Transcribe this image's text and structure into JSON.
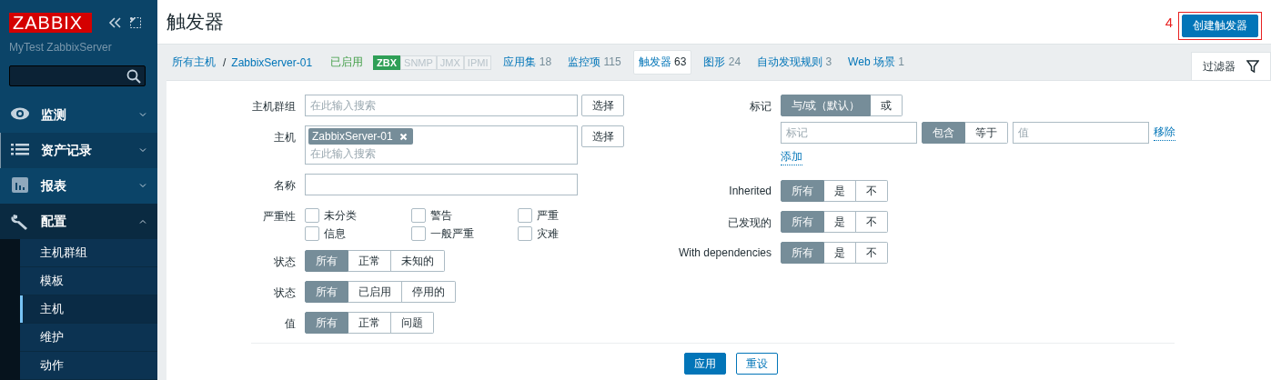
{
  "sidebar": {
    "logo": "ZABBIX",
    "server_name": "MyTest ZabbixServer",
    "menu": [
      {
        "label": "监测",
        "expanded": false,
        "highlighted": false
      },
      {
        "label": "资产记录",
        "expanded": false,
        "highlighted": true
      },
      {
        "label": "报表",
        "expanded": false,
        "highlighted": false
      },
      {
        "label": "配置",
        "expanded": true,
        "highlighted": false,
        "children": [
          {
            "label": "主机群组",
            "selected": false
          },
          {
            "label": "模板",
            "selected": false
          },
          {
            "label": "主机",
            "selected": true
          },
          {
            "label": "维护",
            "selected": false
          },
          {
            "label": "动作",
            "selected": false
          }
        ]
      }
    ]
  },
  "header": {
    "title": "触发器",
    "annotation": "4",
    "create_button": "创建触发器"
  },
  "nav": {
    "breadcrumb": [
      "所有主机",
      "ZabbixServer-01"
    ],
    "breadcrumb_separator": "/",
    "status": "已启用",
    "availability": [
      {
        "label": "ZBX",
        "on": true
      },
      {
        "label": "SNMP",
        "on": false
      },
      {
        "label": "JMX",
        "on": false
      },
      {
        "label": "IPMI",
        "on": false
      }
    ],
    "tabs": [
      {
        "label": "应用集",
        "count": "18",
        "selected": false
      },
      {
        "label": "监控项",
        "count": "115",
        "selected": false
      },
      {
        "label": "触发器",
        "count": "63",
        "selected": true
      },
      {
        "label": "图形",
        "count": "24",
        "selected": false
      },
      {
        "label": "自动发现规则",
        "count": "3",
        "selected": false
      },
      {
        "label": "Web 场景",
        "count": "1",
        "selected": false
      }
    ],
    "filter_tab": {
      "label": "过滤器",
      "selected": true
    }
  },
  "filter": {
    "left": [
      {
        "kind": "multiselect",
        "label": "主机群组",
        "placeholder": "在此输入搜索",
        "button": "选择"
      },
      {
        "kind": "multiselect",
        "label": "主机",
        "chips": [
          "ZabbixServer-01"
        ],
        "placeholder": "在此输入搜索",
        "button": "选择"
      },
      {
        "kind": "text",
        "label": "名称"
      },
      {
        "kind": "checkboxes",
        "label": "严重性",
        "options": [
          {
            "label": "未分类",
            "checked": false
          },
          {
            "label": "信息",
            "checked": false
          },
          {
            "label": "警告",
            "checked": false
          },
          {
            "label": "一般严重",
            "checked": false
          },
          {
            "label": "严重",
            "checked": false
          },
          {
            "label": "灾难",
            "checked": false
          }
        ]
      },
      {
        "kind": "radio",
        "label": "状态",
        "options": [
          {
            "label": "所有",
            "selected": true
          },
          {
            "label": "正常",
            "selected": false
          },
          {
            "label": "未知的",
            "selected": false
          }
        ]
      },
      {
        "kind": "radio",
        "label": "状态",
        "options": [
          {
            "label": "所有",
            "selected": true
          },
          {
            "label": "已启用",
            "selected": false
          },
          {
            "label": "停用的",
            "selected": false
          }
        ]
      },
      {
        "kind": "radio",
        "label": "值",
        "options": [
          {
            "label": "所有",
            "selected": true
          },
          {
            "label": "正常",
            "selected": false
          },
          {
            "label": "问题",
            "selected": false
          }
        ]
      }
    ],
    "right": [
      {
        "kind": "tags",
        "label": "标记",
        "operator": [
          {
            "label": "与/或（默认）",
            "selected": true
          },
          {
            "label": "或",
            "selected": false
          }
        ],
        "tag_placeholder": "标记",
        "match": [
          {
            "label": "包含",
            "selected": true
          },
          {
            "label": "等于",
            "selected": false
          }
        ],
        "value_placeholder": "值",
        "remove": "移除",
        "add": "添加"
      },
      {
        "kind": "radio",
        "label": "Inherited",
        "options": [
          {
            "label": "所有",
            "selected": true
          },
          {
            "label": "是",
            "selected": false
          },
          {
            "label": "不",
            "selected": false
          }
        ]
      },
      {
        "kind": "radio",
        "label": "已发现的",
        "options": [
          {
            "label": "所有",
            "selected": true
          },
          {
            "label": "是",
            "selected": false
          },
          {
            "label": "不",
            "selected": false
          }
        ]
      },
      {
        "kind": "radio",
        "label": "With dependencies",
        "options": [
          {
            "label": "所有",
            "selected": true
          },
          {
            "label": "是",
            "selected": false
          },
          {
            "label": "不",
            "selected": false
          }
        ]
      }
    ],
    "buttons": [
      {
        "label": "应用",
        "primary": true
      },
      {
        "label": "重设",
        "primary": false
      }
    ]
  }
}
